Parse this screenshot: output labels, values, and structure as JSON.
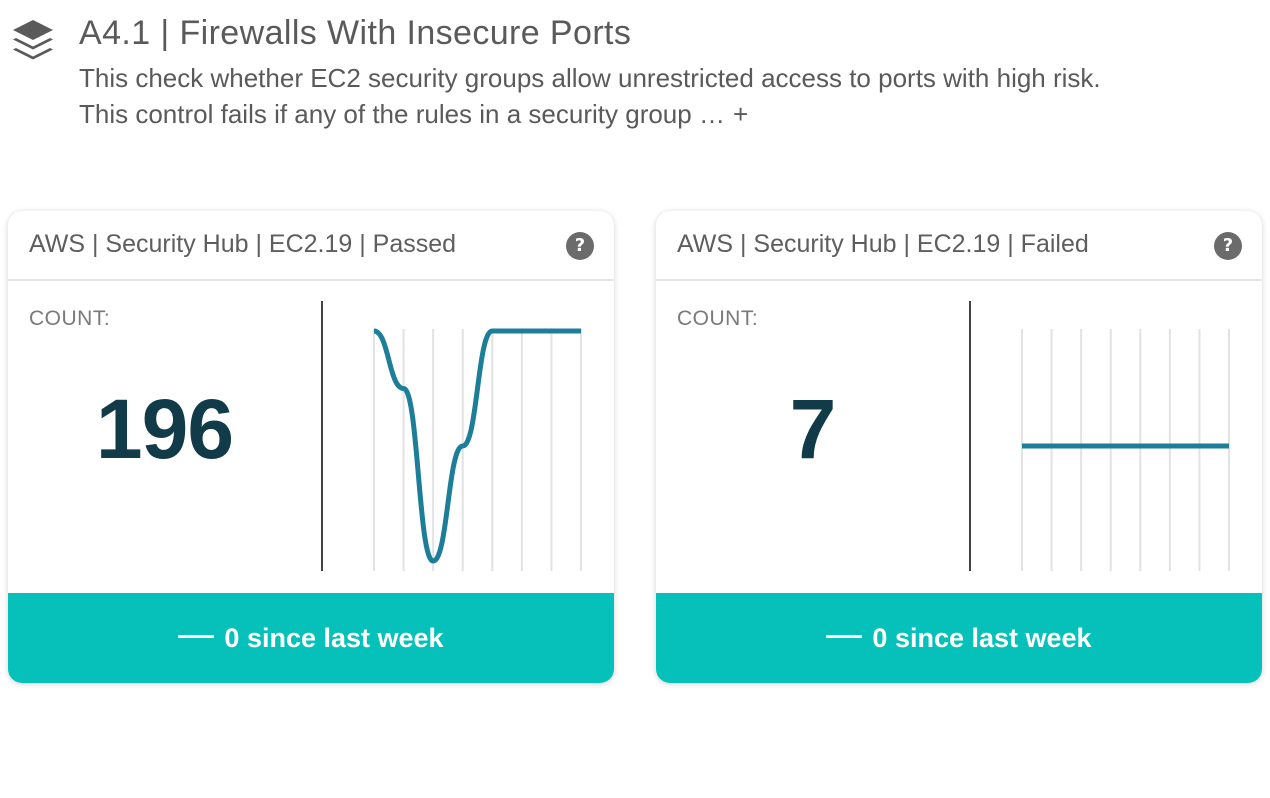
{
  "header": {
    "icon": "layers-icon",
    "title": "A4.1 | Firewalls With Insecure Ports",
    "description_line1": "This check whether EC2 security groups allow unrestricted access to ports with high risk.",
    "description_line2": "This control fails if any of the rules in a security group …",
    "expand_label": "+"
  },
  "colors": {
    "accent": "#05c1b9",
    "sparkline": "#1c7e98",
    "count_text": "#123b4a"
  },
  "cards": [
    {
      "title": "AWS | Security Hub | EC2.19 | Passed",
      "help_icon": "?",
      "count_label": "COUNT:",
      "count_value": "196",
      "footer_label": "0 since last week",
      "sparkline_points": [
        0.0,
        0.25,
        1.0,
        0.5,
        0.0,
        0.0,
        0.0,
        0.0
      ]
    },
    {
      "title": "AWS | Security Hub | EC2.19 | Failed",
      "help_icon": "?",
      "count_label": "COUNT:",
      "count_value": "7",
      "footer_label": "0 since last week",
      "sparkline_points": [
        0.5,
        0.5,
        0.5,
        0.5,
        0.5,
        0.5,
        0.5,
        0.5
      ]
    }
  ]
}
